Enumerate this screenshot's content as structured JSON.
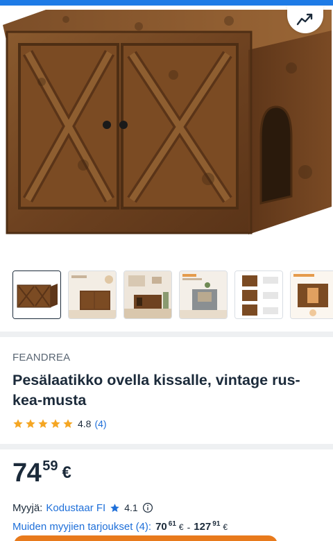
{
  "icons": {
    "share": "share-arrow-icon",
    "star": "star-icon",
    "info": "info-circle-icon"
  },
  "colors": {
    "accent_blue": "#1e7be6",
    "link": "#1e6fd9",
    "star": "#f5a623",
    "text": "#1b2a3a",
    "cta": "#e87a1c",
    "wood_mid": "#7a4a24",
    "wood_dark": "#4e2e14"
  },
  "gallery": {
    "main_image_alt": "Wooden cat litter box cabinet",
    "thumbnails": [
      {
        "name": "thumb-1",
        "active": true
      },
      {
        "name": "thumb-2",
        "active": false
      },
      {
        "name": "thumb-3",
        "active": false
      },
      {
        "name": "thumb-4",
        "active": false
      },
      {
        "name": "thumb-5",
        "active": false
      },
      {
        "name": "thumb-6",
        "active": false
      }
    ]
  },
  "product": {
    "brand": "FEANDREA",
    "title": "Pesälaatikko ovella kissalle, vintage rus-kea-musta",
    "rating_value": "4.8",
    "rating_count": "(4)",
    "stars_filled": 5
  },
  "price": {
    "integer": "74",
    "decimal": "59",
    "currency": "€"
  },
  "seller": {
    "label": "Myyjä:",
    "name": "Kodustaar FI",
    "rating": "4.1"
  },
  "other_offers": {
    "link_text": "Muiden myyjien tarjoukset (4):",
    "low_int": "70",
    "low_dec": "61",
    "low_cur": "€",
    "dash": "-",
    "high_int": "127",
    "high_dec": "91",
    "high_cur": "€"
  }
}
